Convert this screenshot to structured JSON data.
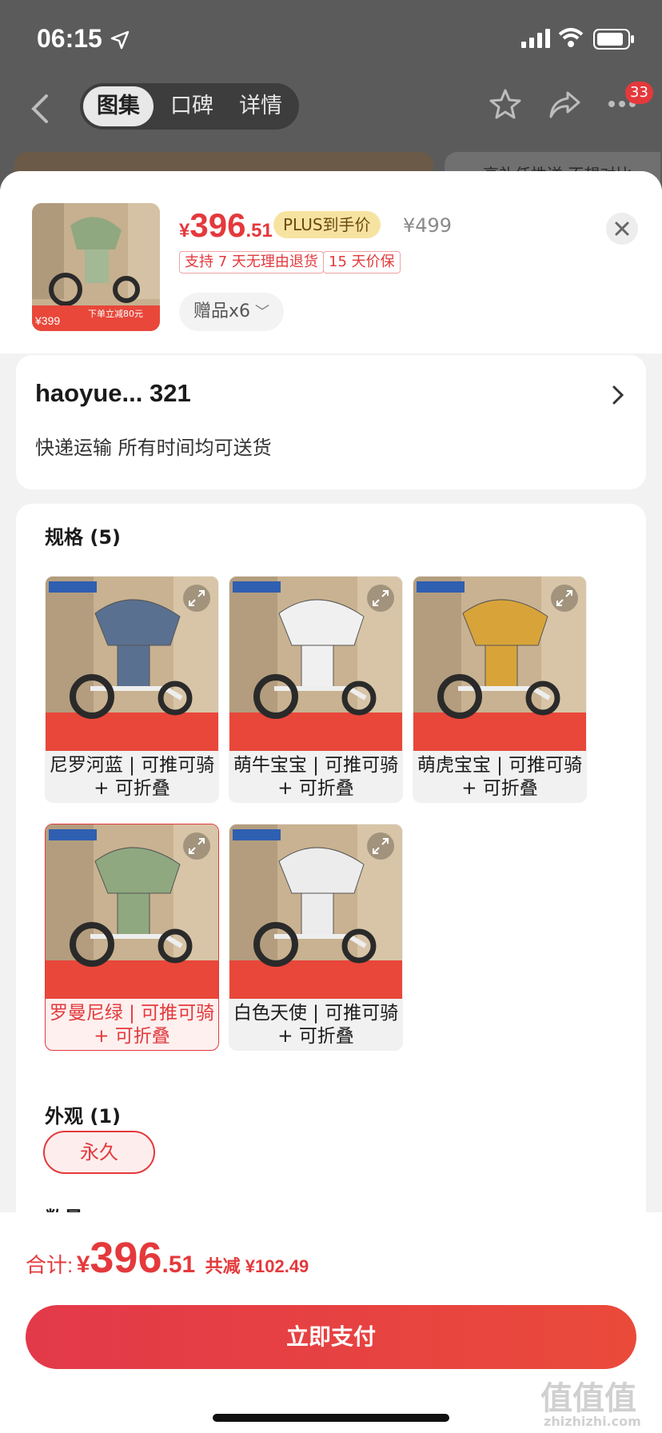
{
  "status_bar": {
    "time": "06:15"
  },
  "nav": {
    "tabs": [
      "图集",
      "口碑",
      "详情"
    ],
    "active_tab": "图集",
    "badge_count": "33",
    "behind_text": "高礼任性送 不想对比"
  },
  "product": {
    "price_currency": "¥",
    "price_int": "396",
    "price_dec": ".51",
    "plus_tag": "PLUS到手价",
    "original_price": "¥499",
    "services": [
      "支持 7 天无理由退货",
      "15 天价保"
    ],
    "gift_label": "赠品x6",
    "thumb_price": "¥399",
    "thumb_promo": "下单立减80元"
  },
  "address": {
    "name": "haoyue...  321",
    "delivery": "快递运输 所有时间均可送货"
  },
  "spec": {
    "title": "规格 (5)",
    "options": [
      {
        "label": "尼罗河蓝 | 可推可骑 + 可折叠",
        "canopy": "#5a7090",
        "selected": false
      },
      {
        "label": "萌牛宝宝 | 可推可骑 + 可折叠",
        "canopy": "#f0f0f0",
        "selected": false
      },
      {
        "label": "萌虎宝宝 | 可推可骑 + 可折叠",
        "canopy": "#d8a43a",
        "selected": false
      },
      {
        "label": "罗曼尼绿 | 可推可骑 + 可折叠",
        "canopy": "#8fa880",
        "selected": true
      },
      {
        "label": "白色天使 | 可推可骑 + 可折叠",
        "canopy": "#ececec",
        "selected": false
      }
    ]
  },
  "appearance": {
    "title": "外观 (1)",
    "option": "永久"
  },
  "quantity": {
    "label": "数量"
  },
  "footer": {
    "total_label": "合计:",
    "currency": "¥",
    "total_int": "396",
    "total_dec": ".51",
    "saved": "共减 ¥102.49",
    "pay_button": "立即支付"
  },
  "colors": {
    "accent": "#e4393c",
    "plus_tag_bg": "#f7e3a1"
  },
  "watermark": {
    "text": "值值值",
    "sub": "zhizhizhi.com"
  }
}
